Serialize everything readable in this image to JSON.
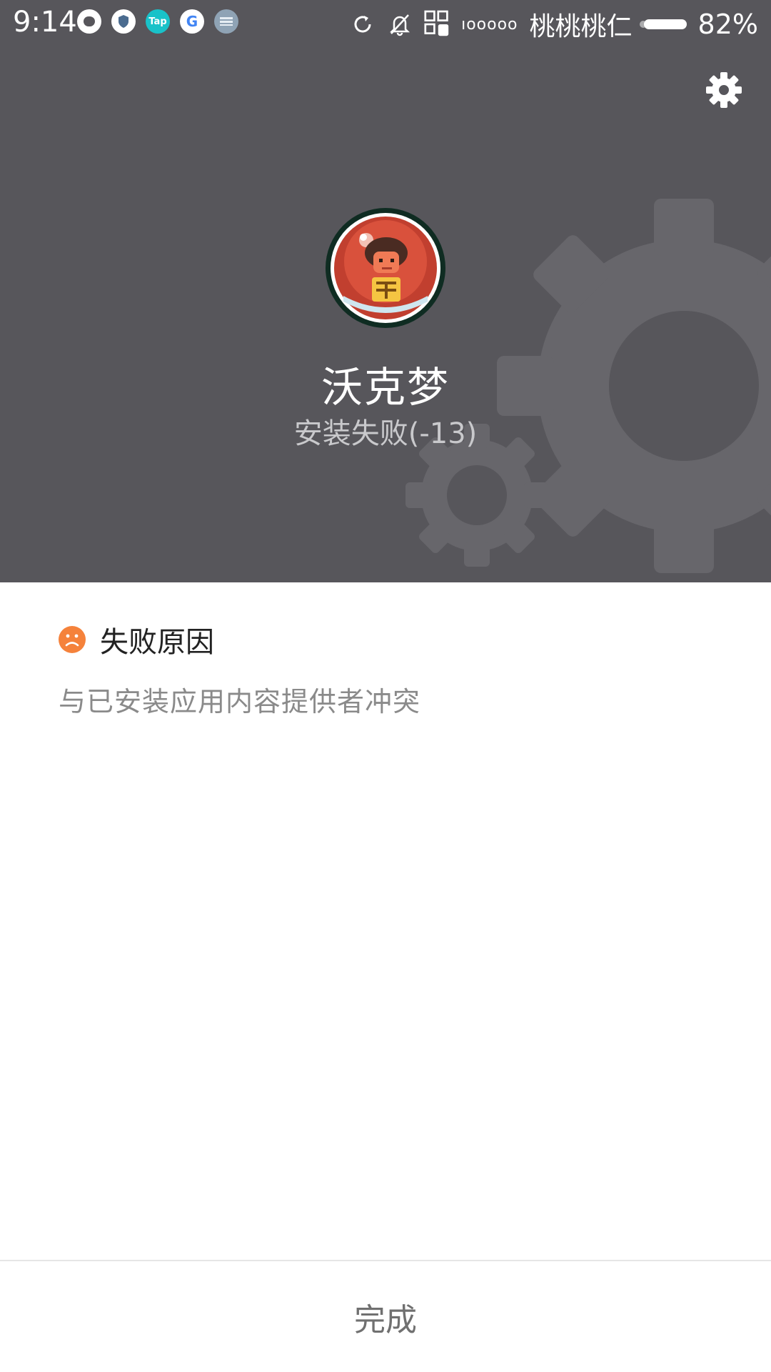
{
  "status_bar": {
    "time": "9:14",
    "notification_icons": [
      "message-icon",
      "shield-icon",
      "tap-icon",
      "google-icon",
      "list-icon"
    ],
    "tap_label": "Tap",
    "google_label": "G",
    "signal_label": "ıooooo",
    "carrier": "桃桃桃仁",
    "battery": "82%"
  },
  "header": {
    "settings_icon": "gear-icon",
    "app_name": "沃克梦",
    "install_status": "安装失败(-13)",
    "background_color": "#57565b"
  },
  "reason": {
    "title": "失败原因",
    "icon": "sad-face-icon",
    "icon_color": "#f5823b",
    "text": "与已安装应用内容提供者冲突"
  },
  "footer": {
    "done_label": "完成"
  }
}
